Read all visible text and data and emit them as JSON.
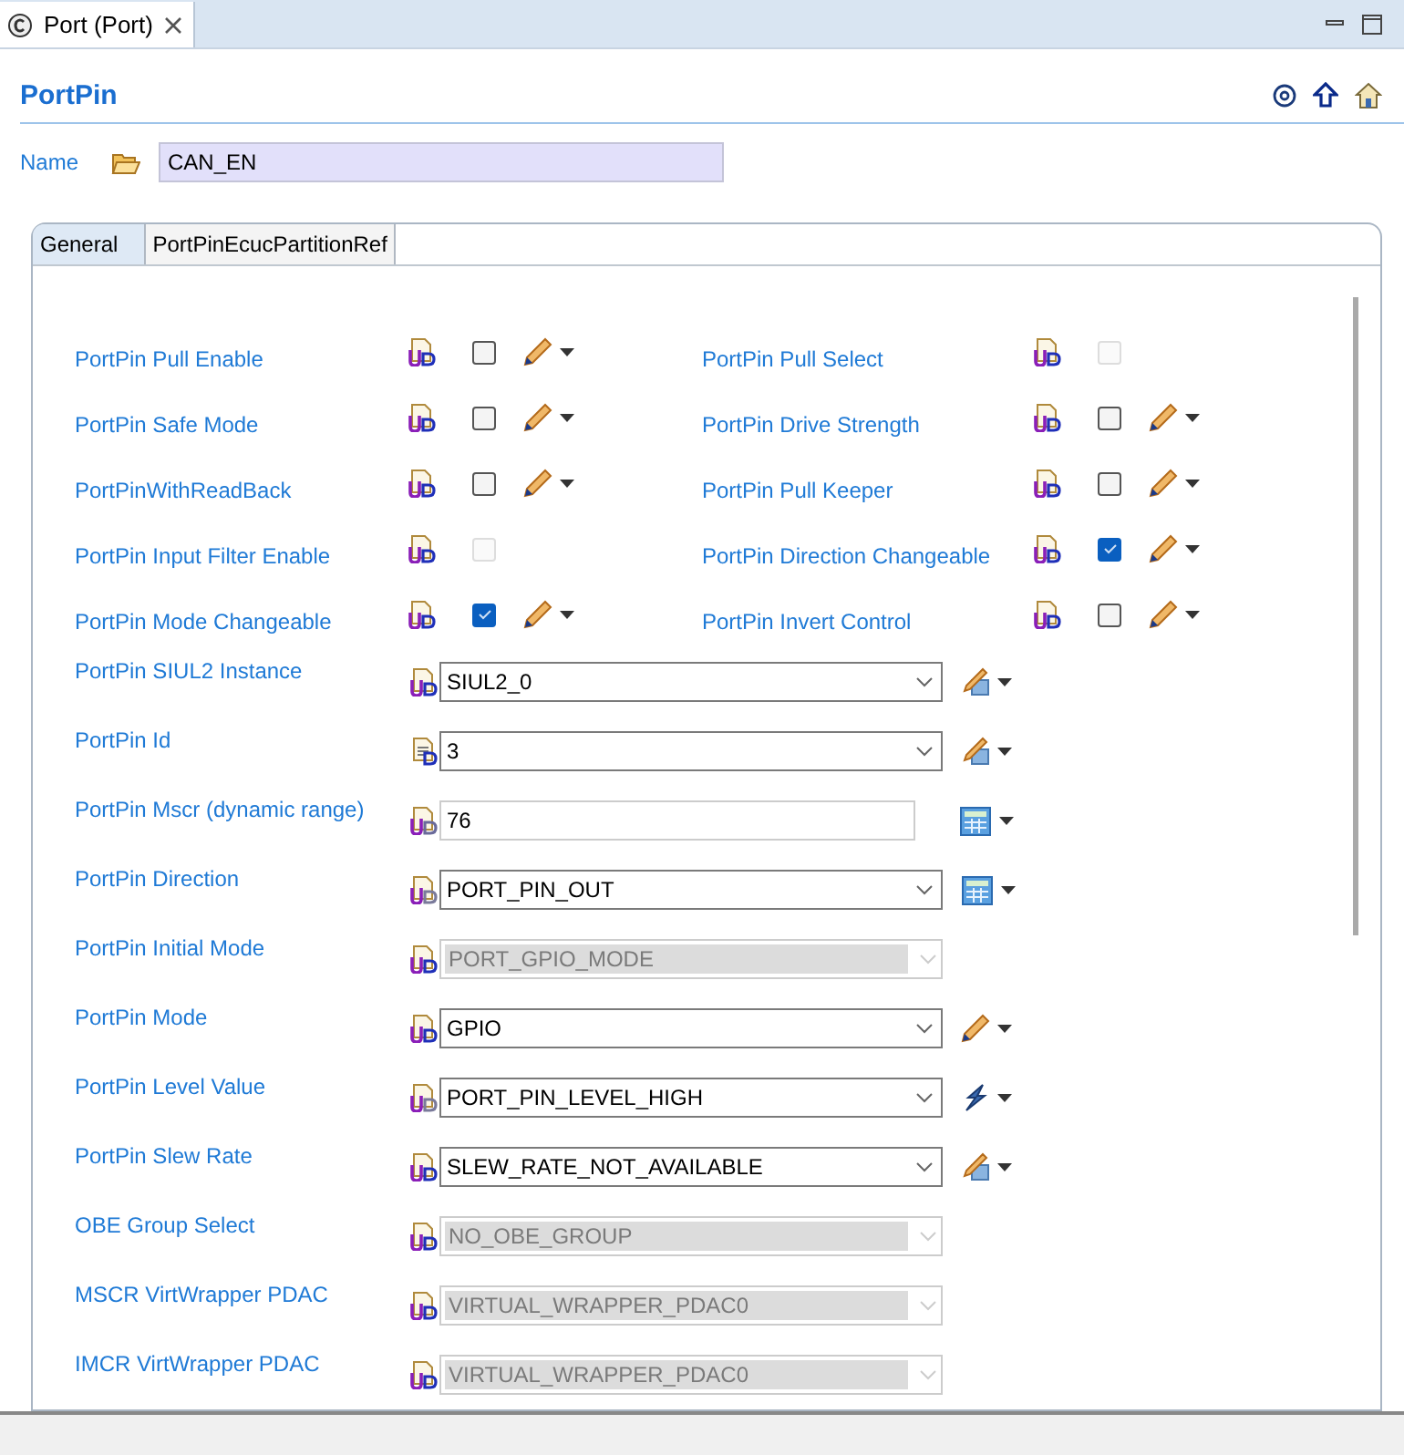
{
  "editor_tab": {
    "title": "Port (Port)"
  },
  "header": {
    "title": "PortPin"
  },
  "name_field": {
    "label": "Name",
    "value": "CAN_EN"
  },
  "tabs": [
    {
      "label": "General",
      "selected": true
    },
    {
      "label": "PortPinEcucPartitionRef",
      "selected": false
    }
  ],
  "checkbox_rows": [
    [
      {
        "label": "PortPin Pull Enable",
        "checked": false,
        "disabled": false
      },
      {
        "label": "PortPin Pull Select",
        "checked": false,
        "disabled": true
      }
    ],
    [
      {
        "label": "PortPin Safe Mode",
        "checked": false,
        "disabled": false
      },
      {
        "label": "PortPin Drive Strength",
        "checked": false,
        "disabled": false
      }
    ],
    [
      {
        "label": "PortPinWithReadBack",
        "checked": false,
        "disabled": false
      },
      {
        "label": "PortPin Pull Keeper",
        "checked": false,
        "disabled": false
      }
    ],
    [
      {
        "label": "PortPin Input Filter Enable",
        "checked": false,
        "disabled": true
      },
      {
        "label": "PortPin Direction Changeable",
        "checked": true,
        "disabled": false
      }
    ],
    [
      {
        "label": "PortPin Mode Changeable",
        "checked": true,
        "disabled": false
      },
      {
        "label": "PortPin Invert Control",
        "checked": false,
        "disabled": false
      }
    ]
  ],
  "fields": [
    {
      "label": "PortPin SIUL2 Instance",
      "kind": "combo",
      "value": "SIUL2_0",
      "disabled": false
    },
    {
      "label": "PortPin Id",
      "kind": "combo",
      "value": "3",
      "disabled": false
    },
    {
      "label": "PortPin Mscr (dynamic range)",
      "kind": "text",
      "value": "76",
      "disabled": false
    },
    {
      "label": "PortPin Direction",
      "kind": "combo",
      "value": "PORT_PIN_OUT",
      "disabled": false
    },
    {
      "label": "PortPin Initial Mode",
      "kind": "combo",
      "value": "PORT_GPIO_MODE",
      "disabled": true
    },
    {
      "label": "PortPin Mode",
      "kind": "combo",
      "value": "GPIO",
      "disabled": false
    },
    {
      "label": "PortPin Level Value",
      "kind": "combo",
      "value": "PORT_PIN_LEVEL_HIGH",
      "disabled": false
    },
    {
      "label": "PortPin Slew Rate",
      "kind": "combo",
      "value": "SLEW_RATE_NOT_AVAILABLE",
      "disabled": false
    },
    {
      "label": "OBE Group Select",
      "kind": "combo",
      "value": "NO_OBE_GROUP",
      "disabled": true
    },
    {
      "label": "MSCR VirtWrapper PDAC",
      "kind": "combo",
      "value": "VIRTUAL_WRAPPER_PDAC0",
      "disabled": true
    },
    {
      "label": "IMCR VirtWrapper PDAC",
      "kind": "combo",
      "value": "VIRTUAL_WRAPPER_PDAC0",
      "disabled": true
    }
  ]
}
